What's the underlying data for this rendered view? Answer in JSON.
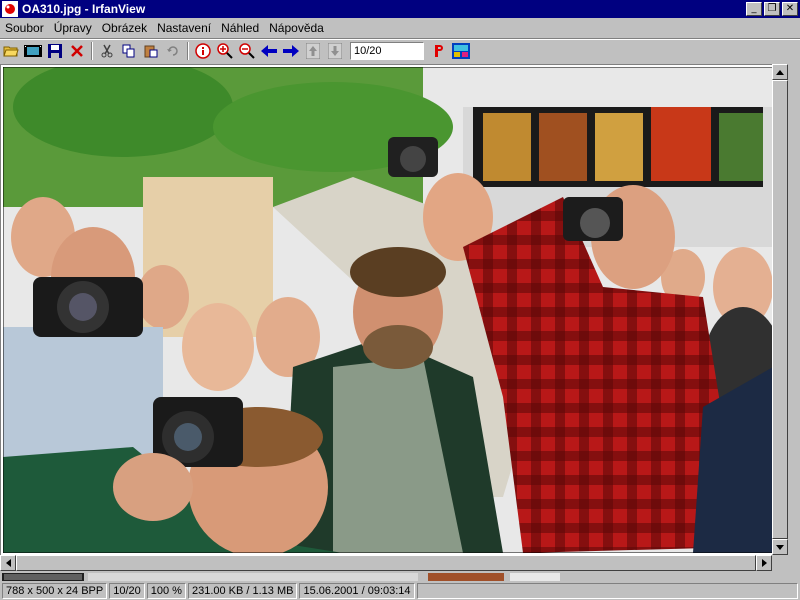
{
  "window": {
    "title": "OA310.jpg - IrfanView",
    "buttons": {
      "minimize": "_",
      "maximize": "❐",
      "close": "✕"
    }
  },
  "menu": {
    "items": [
      "Soubor",
      "Úpravy",
      "Obrázek",
      "Nastavení",
      "Náhled",
      "Nápověda"
    ]
  },
  "toolbar": {
    "page_value": "10/20",
    "icons": [
      "open-folder-icon",
      "slideshow-icon",
      "save-icon",
      "delete-icon",
      "cut-icon",
      "copy-icon",
      "paste-icon",
      "undo-icon",
      "info-icon",
      "zoom-in-icon",
      "zoom-out-icon",
      "previous-icon",
      "next-icon",
      "first-icon",
      "last-icon",
      "print-icon",
      "paint-icon"
    ]
  },
  "status": {
    "dimensions": "788 x 500 x 24 BPP",
    "page": "10/20",
    "zoom": "100 %",
    "filesize": "231.00 KB / 1.13 MB",
    "datetime": "15.06.2001 / 09:03:14"
  },
  "colors": {
    "titlebar": "#000080",
    "chrome": "#c0c0c0"
  }
}
